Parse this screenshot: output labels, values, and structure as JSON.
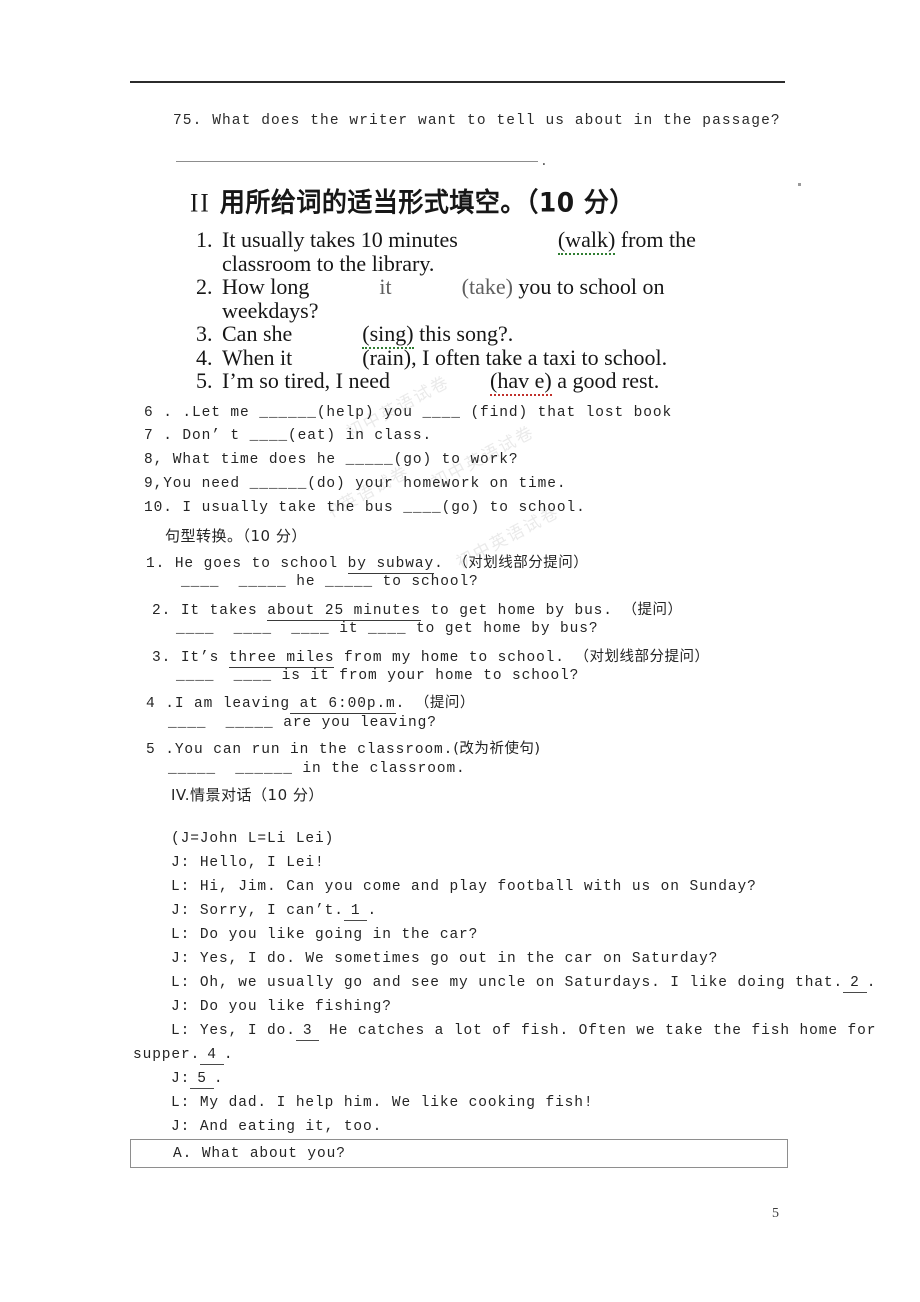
{
  "page": {
    "number": "5",
    "corner_mark": "."
  },
  "reading_question": {
    "text": "75. What does the writer want to tell us about in the passage?",
    "answer_blank_trailing": "."
  },
  "section_two": {
    "roman": "II",
    "heading": "用所给词的适当形式填空。（10 分）",
    "items": [
      {
        "num": "1.",
        "line1_before": "It usually takes 10 minutes",
        "cue": "(walk)",
        "line1_after": "from the",
        "line2": "classroom to the library."
      },
      {
        "num": "2.",
        "line1_before": "How long",
        "mid": "it",
        "cue": "(take)",
        "line1_after": "you to school on",
        "line2": "weekdays?"
      },
      {
        "num": "3.",
        "line1_before": "Can she",
        "cue": "(sing)",
        "line1_after": "this song?."
      },
      {
        "num": "4.",
        "line1_before": "When it",
        "cue": "(rain),",
        "line1_after": "I often take a taxi to school."
      },
      {
        "num": "5.",
        "line1_before": "I’m so tired, I need",
        "cue": "(hav e)",
        "line1_after": "a good rest."
      }
    ],
    "typed_items": [
      "6 . .Let me ______(help) you ____ (find) that lost book",
      "7 . Don’ t ____(eat) in class.",
      "8, What time does he _____(go) to work?",
      "9,You need ______(do) your homework on time.",
      "10. I usually take the bus ____(go) to school."
    ],
    "watermark_lines": [
      "初中英语试卷",
      "初中英语试卷",
      "初中英语试卷",
      "初中英语试卷"
    ]
  },
  "section_three": {
    "heading": "句型转换。（10 分）",
    "items": [
      {
        "num": "1.",
        "prompt_before": "He goes to school ",
        "underlined": "by subway",
        "prompt_after": ".",
        "instruction": "（对划线部分提问）",
        "answer": "____  _____ he _____ to school?"
      },
      {
        "num": "2.",
        "prompt_before": "It takes ",
        "underlined": "about 25 minutes",
        "prompt_after": " to get home by bus.",
        "instruction": "（提问）",
        "answer": "____  ____  ____ it ____ to get home by bus?"
      },
      {
        "num": "3.",
        "prompt_before": "It’s ",
        "underlined": "three miles",
        "prompt_after": " from my home to school.",
        "instruction": "（对划线部分提问）",
        "answer": "____  ____ is it from your home to school?"
      },
      {
        "num": "4 .",
        "prompt_before": "I am leaving",
        "underlined": " at 6:00p.m",
        "prompt_after": ".",
        "instruction": "（提问）",
        "answer": "____  _____ are you leaving?"
      },
      {
        "num": "5 .",
        "prompt_before": "You can run in the classroom.",
        "underlined": "",
        "prompt_after": "",
        "instruction": "(改为祈使句)",
        "answer": "_____  ______ in the classroom."
      }
    ]
  },
  "section_four": {
    "heading": "IV.情景对话（10 分）",
    "speakers_note": "(J=John L=Li Lei)",
    "dialogue": [
      {
        "speaker": "J:",
        "text": "Hello, I Lei!"
      },
      {
        "speaker": "L:",
        "text": "Hi, Jim. Can you come and play football with us on Sunday?"
      },
      {
        "speaker": "J:",
        "text": "Sorry, I can’t.",
        "blank": "1",
        "tail": "."
      },
      {
        "speaker": "L:",
        "text": "Do you like going in the car?"
      },
      {
        "speaker": "J:",
        "text": "Yes, I do. We sometimes go out in the car on Saturday?"
      },
      {
        "speaker": "L:",
        "text": "Oh, we usually go and see my uncle on Saturdays. I like doing that.",
        "blank": "2",
        "tail": "."
      },
      {
        "speaker": "J:",
        "text": "Do you like fishing?"
      },
      {
        "speaker": "L:",
        "text": "Yes, I do.",
        "blank": "3",
        "text2": "He catches a lot of fish. Often we take the fish home for"
      },
      {
        "speaker": "",
        "text": "supper.",
        "blank": "4",
        "tail": "."
      },
      {
        "speaker": "J:",
        "text": "",
        "blank": "5",
        "tail": "."
      },
      {
        "speaker": "L:",
        "text": "My dad. I help him. We like cooking fish!"
      },
      {
        "speaker": "J:",
        "text": "And eating it, too."
      }
    ],
    "options": [
      {
        "label": "A.",
        "text": "What about you?"
      }
    ]
  }
}
